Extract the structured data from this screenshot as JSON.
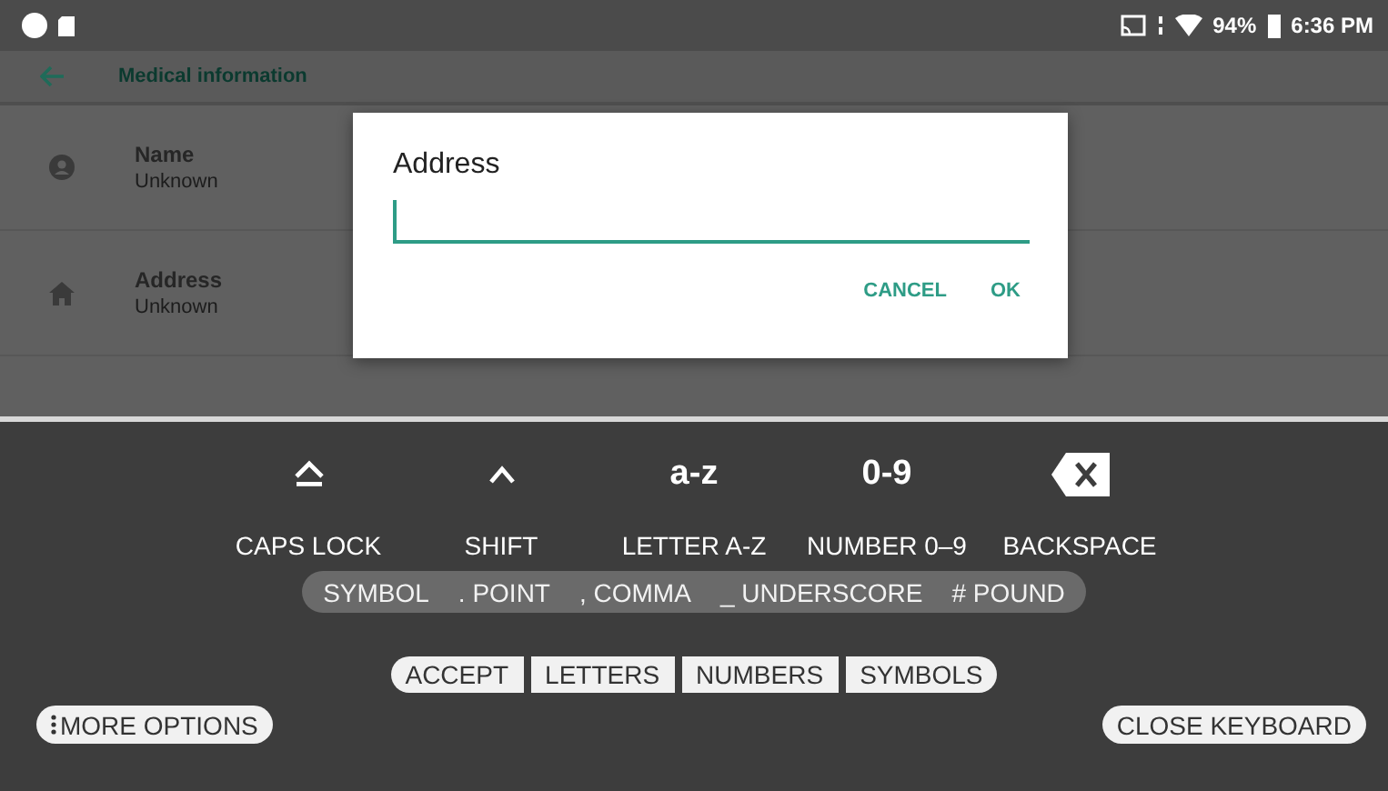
{
  "status_bar": {
    "battery": "94%",
    "time": "6:36 PM"
  },
  "app_bar": {
    "title": "Medical information"
  },
  "items": [
    {
      "kind": "person",
      "label": "Name",
      "value": "Unknown"
    },
    {
      "kind": "home",
      "label": "Address",
      "value": "Unknown"
    }
  ],
  "dialog": {
    "title": "Address",
    "buttons": [
      "CANCEL",
      "OK"
    ]
  },
  "keyboard": {
    "keys": [
      {
        "kind": "caps",
        "label": "CAPS LOCK"
      },
      {
        "kind": "shift",
        "label": "SHIFT"
      },
      {
        "kind": "text",
        "text": "a-z",
        "label": "LETTER A-Z"
      },
      {
        "kind": "text",
        "text": "0-9",
        "label": "NUMBER 0–9"
      },
      {
        "kind": "backspace",
        "label": "BACKSPACE"
      }
    ],
    "symbols": [
      "SYMBOL",
      ". POINT",
      ", COMMA",
      "_ UNDERSCORE",
      "# POUND"
    ],
    "modes": [
      "ACCEPT",
      "LETTERS",
      "NUMBERS",
      "SYMBOLS"
    ],
    "more_options": "MORE OPTIONS",
    "close": "CLOSE KEYBOARD"
  }
}
